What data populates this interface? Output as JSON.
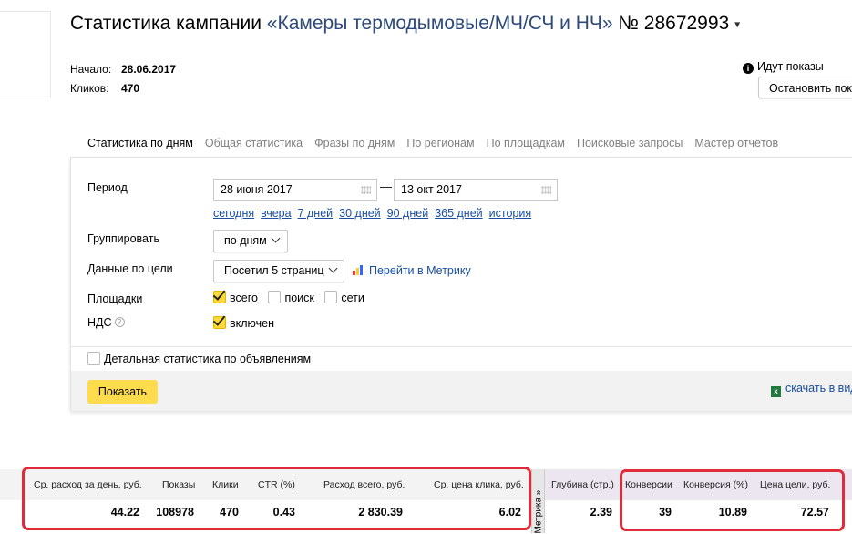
{
  "header": {
    "title_prefix": "Статистика кампании",
    "campaign_name": "«Камеры термодымовые/МЧ/СЧ и НЧ»",
    "campaign_number": "№ 28672993",
    "start_label": "Начало:",
    "start_value": "28.06.2017",
    "clicks_label": "Кликов:",
    "clicks_value": "470",
    "status_text": "Идут показы",
    "stop_button": "Остановить пока"
  },
  "tabs": [
    {
      "label": "Статистика по дням"
    },
    {
      "label": "Общая статистика"
    },
    {
      "label": "Фразы по дням"
    },
    {
      "label": "По регионам"
    },
    {
      "label": "По площадкам"
    },
    {
      "label": "Поисковые запросы"
    },
    {
      "label": "Мастер отчётов"
    }
  ],
  "form": {
    "period_label": "Период",
    "date_from": "28 июня 2017",
    "date_to": "13 окт 2017",
    "quick_links": [
      "сегодня",
      "вчера",
      "7 дней",
      "30 дней",
      "90 дней",
      "365 дней",
      "история"
    ],
    "group_label": "Группировать",
    "group_value": "по дням",
    "goal_label": "Данные по цели",
    "goal_value": "Посетил 5 страниц",
    "metrika_link": "Перейти в Метрику",
    "places_label": "Площадки",
    "place_all": "всего",
    "place_search": "поиск",
    "place_networks": "сети",
    "vat_label": "НДС",
    "vat_value": "включен",
    "detail_label": "Детальная статистика по объявлениям",
    "show_button": "Показать",
    "download_link": "скачать в виде"
  },
  "stats": {
    "headers": [
      "Ср. расход за день, руб.",
      "Показы",
      "Клики",
      "CTR (%)",
      "Расход всего, руб.",
      "Ср. цена клика, руб."
    ],
    "values": [
      "44.22",
      "108978",
      "470",
      "0.43",
      "2 830.39",
      "6.02"
    ],
    "metrika_label": "Метрика »",
    "metrika_headers": [
      "Глубина (стр.)",
      "Конверсии",
      "Конверсия (%)",
      "Цена цели, руб."
    ],
    "metrika_values": [
      "2.39",
      "39",
      "10.89",
      "72.57"
    ]
  },
  "colors": {
    "accent_tab": "#e03a2c",
    "link": "#1a4ea0",
    "button_yellow": "#ffdb4d",
    "highlight_red": "#e02c3a"
  }
}
